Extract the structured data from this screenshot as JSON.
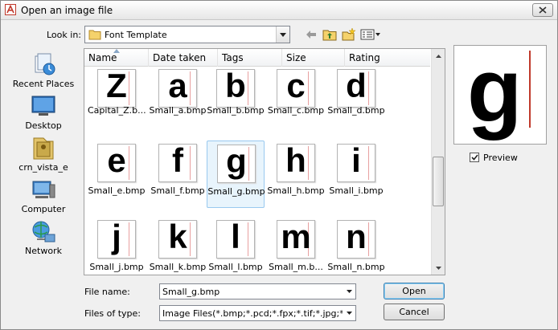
{
  "window": {
    "title": "Open an image file"
  },
  "lookin": {
    "label": "Look in:",
    "value": "Font Template"
  },
  "places": [
    {
      "label": "Recent Places",
      "icon": "recent-places-icon"
    },
    {
      "label": "Desktop",
      "icon": "desktop-icon"
    },
    {
      "label": "crn_vista_e",
      "icon": "user-folder-icon"
    },
    {
      "label": "Computer",
      "icon": "computer-icon"
    },
    {
      "label": "Network",
      "icon": "network-icon"
    }
  ],
  "columns": [
    "Name",
    "Date taken",
    "Tags",
    "Size",
    "Rating"
  ],
  "files": [
    {
      "glyph": "Z",
      "label": "Capital_Z.b..."
    },
    {
      "glyph": "a",
      "label": "Small_a.bmp"
    },
    {
      "glyph": "b",
      "label": "Small_b.bmp"
    },
    {
      "glyph": "c",
      "label": "Small_c.bmp"
    },
    {
      "glyph": "d",
      "label": "Small_d.bmp"
    },
    {
      "glyph": "e",
      "label": "Small_e.bmp"
    },
    {
      "glyph": "f",
      "label": "Small_f.bmp"
    },
    {
      "glyph": "g",
      "label": "Small_g.bmp"
    },
    {
      "glyph": "h",
      "label": "Small_h.bmp"
    },
    {
      "glyph": "i",
      "label": "Small_i.bmp"
    },
    {
      "glyph": "j",
      "label": "Small_j.bmp"
    },
    {
      "glyph": "k",
      "label": "Small_k.bmp"
    },
    {
      "glyph": "l",
      "label": "Small_l.bmp"
    },
    {
      "glyph": "m",
      "label": "Small_m.b..."
    },
    {
      "glyph": "n",
      "label": "Small_n.bmp"
    }
  ],
  "selected_file": "Small_g.bmp",
  "preview": {
    "glyph": "g",
    "label": "Preview",
    "checked": true
  },
  "filename": {
    "label": "File name:",
    "value": "Small_g.bmp"
  },
  "filetype": {
    "label": "Files of type:",
    "value": "Image Files(*.bmp;*.pcd;*.fpx;*.tif;*.jpg;*.pcx;*.wmf)"
  },
  "buttons": {
    "open": "Open",
    "cancel": "Cancel"
  },
  "colors": {
    "selection": "#e8f4fc",
    "selection_border": "#99c9ef",
    "preview_line": "#c0392b"
  }
}
